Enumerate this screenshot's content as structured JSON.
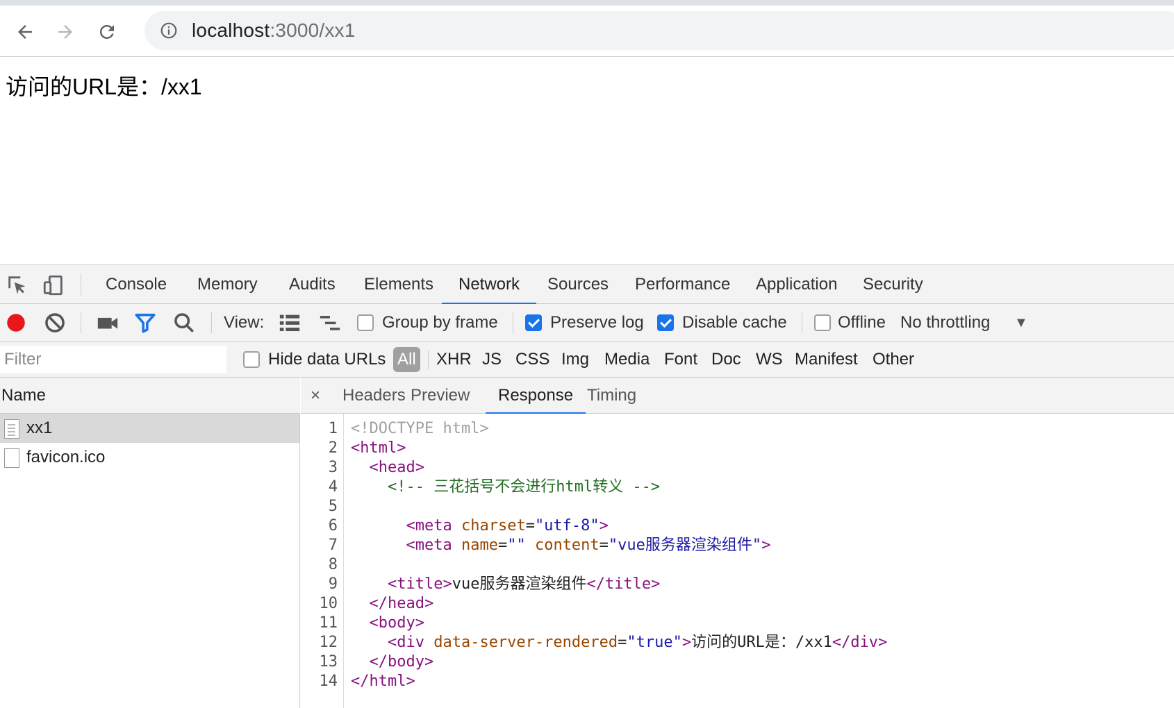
{
  "browser": {
    "url_host": "localhost",
    "url_rest": ":3000/xx1"
  },
  "page": {
    "text": "访问的URL是：/xx1"
  },
  "devtools": {
    "tabs": [
      "Console",
      "Memory",
      "Audits",
      "Elements",
      "Network",
      "Sources",
      "Performance",
      "Application",
      "Security"
    ],
    "active_tab": "Network",
    "network_toolbar": {
      "view_label": "View:",
      "group_by_frame": "Group by frame",
      "group_by_frame_checked": false,
      "preserve_log": "Preserve log",
      "preserve_log_checked": true,
      "disable_cache": "Disable cache",
      "disable_cache_checked": true,
      "offline": "Offline",
      "offline_checked": false,
      "throttling": "No throttling"
    },
    "filter": {
      "placeholder": "Filter",
      "hide_data_urls": "Hide data URLs",
      "types": [
        "All",
        "XHR",
        "JS",
        "CSS",
        "Img",
        "Media",
        "Font",
        "Doc",
        "WS",
        "Manifest",
        "Other"
      ]
    },
    "name_header": "Name",
    "requests": [
      {
        "name": "xx1",
        "selected": true
      },
      {
        "name": "favicon.ico",
        "selected": false
      }
    ],
    "detail_tabs": [
      "Headers",
      "Preview",
      "Response",
      "Timing"
    ],
    "active_detail_tab": "Response",
    "close_symbol": "×",
    "response_lines": [
      {
        "n": "1",
        "parts": [
          {
            "t": "doctype",
            "s": "<!DOCTYPE html>"
          }
        ]
      },
      {
        "n": "2",
        "parts": [
          {
            "t": "tag",
            "s": "<html>"
          }
        ]
      },
      {
        "n": "3",
        "parts": [
          {
            "t": "text",
            "s": "  "
          },
          {
            "t": "tag",
            "s": "<head>"
          }
        ]
      },
      {
        "n": "4",
        "parts": [
          {
            "t": "text",
            "s": "    "
          },
          {
            "t": "comment",
            "s": "<!-- 三花括号不会进行html转义 -->"
          }
        ]
      },
      {
        "n": "5",
        "parts": []
      },
      {
        "n": "6",
        "parts": [
          {
            "t": "text",
            "s": "      "
          },
          {
            "t": "tag",
            "s": "<meta "
          },
          {
            "t": "attr",
            "s": "charset"
          },
          {
            "t": "text",
            "s": "="
          },
          {
            "t": "val",
            "s": "\"utf-8\""
          },
          {
            "t": "tag",
            "s": ">"
          }
        ]
      },
      {
        "n": "7",
        "parts": [
          {
            "t": "text",
            "s": "      "
          },
          {
            "t": "tag",
            "s": "<meta "
          },
          {
            "t": "attr",
            "s": "name"
          },
          {
            "t": "text",
            "s": "="
          },
          {
            "t": "val",
            "s": "\"\""
          },
          {
            "t": "text",
            "s": " "
          },
          {
            "t": "attr",
            "s": "content"
          },
          {
            "t": "text",
            "s": "="
          },
          {
            "t": "val",
            "s": "\"vue服务器渲染组件\""
          },
          {
            "t": "tag",
            "s": ">"
          }
        ]
      },
      {
        "n": "8",
        "parts": []
      },
      {
        "n": "9",
        "parts": [
          {
            "t": "text",
            "s": "    "
          },
          {
            "t": "tag",
            "s": "<title>"
          },
          {
            "t": "text",
            "s": "vue服务器渲染组件"
          },
          {
            "t": "tag",
            "s": "</title>"
          }
        ]
      },
      {
        "n": "10",
        "parts": [
          {
            "t": "text",
            "s": "  "
          },
          {
            "t": "tag",
            "s": "</head>"
          }
        ]
      },
      {
        "n": "11",
        "parts": [
          {
            "t": "text",
            "s": "  "
          },
          {
            "t": "tag",
            "s": "<body>"
          }
        ]
      },
      {
        "n": "12",
        "parts": [
          {
            "t": "text",
            "s": "    "
          },
          {
            "t": "tag",
            "s": "<div "
          },
          {
            "t": "attr",
            "s": "data-server-rendered"
          },
          {
            "t": "text",
            "s": "="
          },
          {
            "t": "val",
            "s": "\"true\""
          },
          {
            "t": "tag",
            "s": ">"
          },
          {
            "t": "text",
            "s": "访问的URL是：/xx1"
          },
          {
            "t": "tag",
            "s": "</div>"
          }
        ]
      },
      {
        "n": "13",
        "parts": [
          {
            "t": "text",
            "s": "  "
          },
          {
            "t": "tag",
            "s": "</body>"
          }
        ]
      },
      {
        "n": "14",
        "parts": [
          {
            "t": "tag",
            "s": "</html>"
          }
        ]
      }
    ],
    "icons": {
      "inspect": "inspect-element-icon",
      "device": "device-toolbar-icon",
      "record": "record-icon",
      "clear": "clear-icon",
      "capture": "capture-screenshots-icon",
      "filter": "filter-icon",
      "search": "search-icon",
      "list_view": "large-rows-icon",
      "waterfall_view": "overview-icon"
    },
    "colors": {
      "accent": "#1a73e8",
      "record": "#e8171b"
    }
  }
}
